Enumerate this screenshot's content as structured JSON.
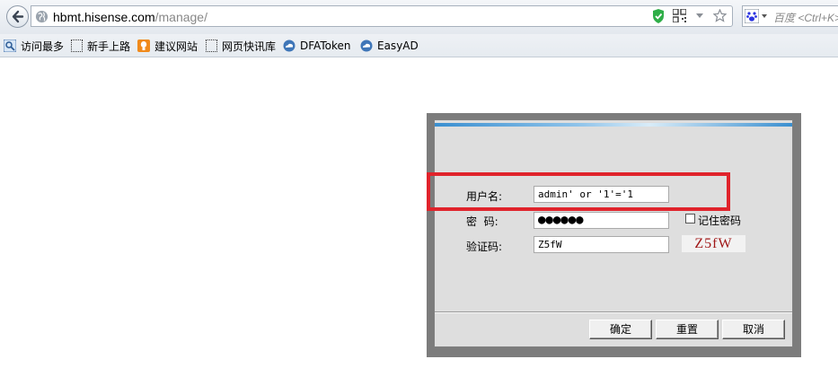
{
  "browser": {
    "url_host": "hbmt.hisense.com",
    "url_path": "/manage/",
    "search_placeholder": "百度 <Ctrl+K>",
    "bookmarks": [
      {
        "label": "访问最多",
        "icon": "search-icon"
      },
      {
        "label": "新手上路",
        "icon": "page-icon"
      },
      {
        "label": "建议网站",
        "icon": "bulb-icon"
      },
      {
        "label": "网页快讯库",
        "icon": "page-icon"
      },
      {
        "label": "DFAToken",
        "icon": "cloud-icon"
      },
      {
        "label": "EasyAD",
        "icon": "cloud-icon"
      }
    ]
  },
  "login": {
    "username_label": "用户名:",
    "username_value": "admin' or '1'='1",
    "password_label": "密  码:",
    "password_value": "●●●●●●",
    "remember_label": "记住密码",
    "remember_checked": false,
    "captcha_label": "验证码:",
    "captcha_value": "Z5fW",
    "captcha_image_text": "Z5fW",
    "buttons": {
      "ok": "确定",
      "reset": "重置",
      "cancel": "取消"
    }
  },
  "colors": {
    "highlight": "#e0232b",
    "captcha": "#a01818"
  }
}
